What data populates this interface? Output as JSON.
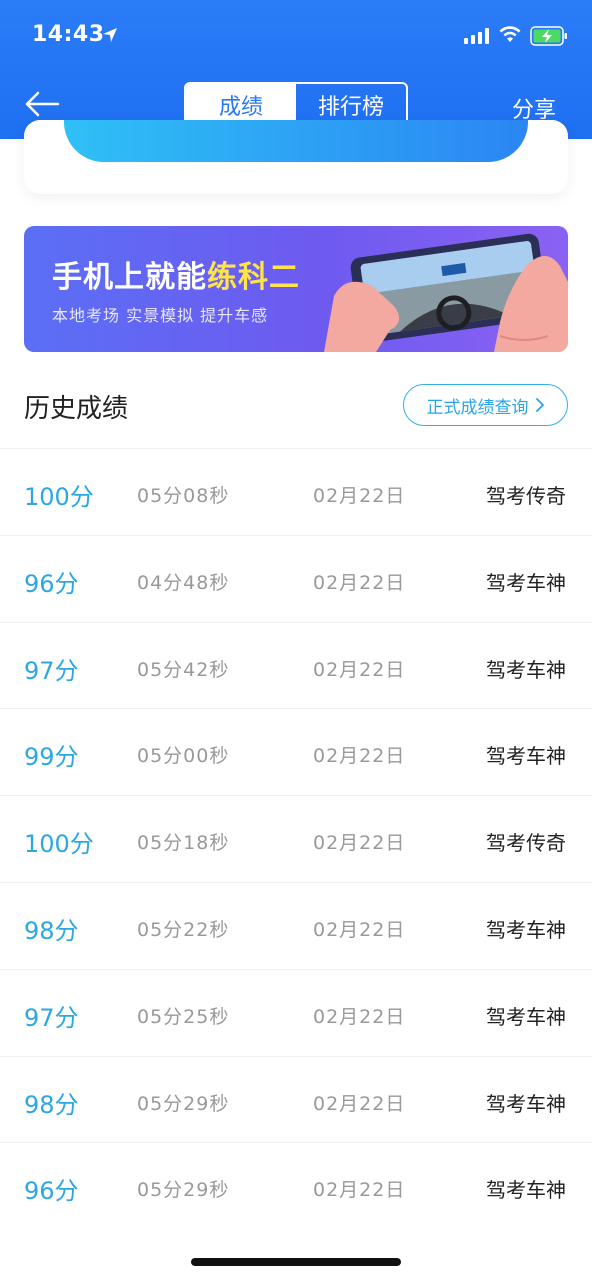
{
  "status_bar": {
    "time": "14:43"
  },
  "nav": {
    "tabs": [
      {
        "label": "成绩",
        "active": true
      },
      {
        "label": "排行榜",
        "active": false
      }
    ],
    "share_label": "分享"
  },
  "banner": {
    "title_prefix": "手机上就能",
    "title_highlight": "练科二",
    "subtitle": "本地考场 实景模拟 提升车感"
  },
  "history": {
    "title": "历史成绩",
    "query_button": "正式成绩查询"
  },
  "records": [
    {
      "score": "100分",
      "duration": "05分08秒",
      "date": "02月22日",
      "title": "驾考传奇"
    },
    {
      "score": "96分",
      "duration": "04分48秒",
      "date": "02月22日",
      "title": "驾考车神"
    },
    {
      "score": "97分",
      "duration": "05分42秒",
      "date": "02月22日",
      "title": "驾考车神"
    },
    {
      "score": "99分",
      "duration": "05分00秒",
      "date": "02月22日",
      "title": "驾考车神"
    },
    {
      "score": "100分",
      "duration": "05分18秒",
      "date": "02月22日",
      "title": "驾考传奇"
    },
    {
      "score": "98分",
      "duration": "05分22秒",
      "date": "02月22日",
      "title": "驾考车神"
    },
    {
      "score": "97分",
      "duration": "05分25秒",
      "date": "02月22日",
      "title": "驾考车神"
    },
    {
      "score": "98分",
      "duration": "05分29秒",
      "date": "02月22日",
      "title": "驾考车神"
    },
    {
      "score": "96分",
      "duration": "05分29秒",
      "date": "02月22日",
      "title": "驾考车神"
    }
  ],
  "colors": {
    "header_blue": "#1f6ff2",
    "score_blue": "#2ba7e4",
    "banner_highlight": "#ffe34a"
  }
}
